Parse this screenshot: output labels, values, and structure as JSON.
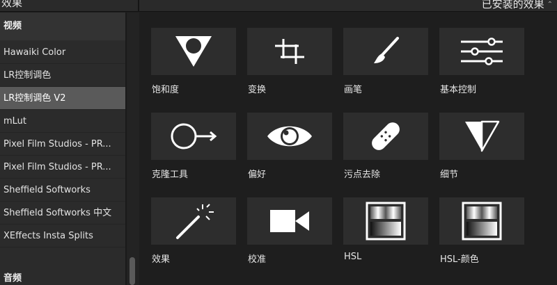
{
  "header": {
    "title": "效果",
    "filter_label": "已安装的效果",
    "filter_chevron": "⌃⌄"
  },
  "sidebar": {
    "video_section": "视频",
    "audio_section": "音频",
    "items": [
      {
        "label": "Hawaiki Color",
        "selected": false
      },
      {
        "label": "LR控制调色",
        "selected": false
      },
      {
        "label": "LR控制调色 V2",
        "selected": true
      },
      {
        "label": "mLut",
        "selected": false
      },
      {
        "label": "Pixel Film Studios - PR...",
        "selected": false
      },
      {
        "label": "Pixel Film Studios - PR...",
        "selected": false
      },
      {
        "label": "Sheffield Softworks",
        "selected": false
      },
      {
        "label": "Sheffield Softworks 中文",
        "selected": false
      },
      {
        "label": "XEffects Insta Splits",
        "selected": false
      }
    ]
  },
  "effects": [
    {
      "label": "饱和度",
      "icon": "triangle-circle-icon"
    },
    {
      "label": "变换",
      "icon": "crop-icon"
    },
    {
      "label": "画笔",
      "icon": "brush-icon"
    },
    {
      "label": "基本控制",
      "icon": "sliders-icon"
    },
    {
      "label": "克隆工具",
      "icon": "clone-icon"
    },
    {
      "label": "偏好",
      "icon": "eye-icon"
    },
    {
      "label": "污点去除",
      "icon": "bandage-icon"
    },
    {
      "label": "细节",
      "icon": "detail-triangle-icon"
    },
    {
      "label": "效果",
      "icon": "magic-wand-icon"
    },
    {
      "label": "校准",
      "icon": "video-camera-icon"
    },
    {
      "label": "HSL",
      "icon": "hsl-gradient-icon"
    },
    {
      "label": "HSL-颜色",
      "icon": "hsl-gradient-icon"
    }
  ],
  "colors": {
    "background": "#1e1e1e",
    "sidebar": "#2b2b2b",
    "selected_item": "#5a5a5a",
    "tile": "#2d2d2d",
    "icon": "#ffffff"
  }
}
